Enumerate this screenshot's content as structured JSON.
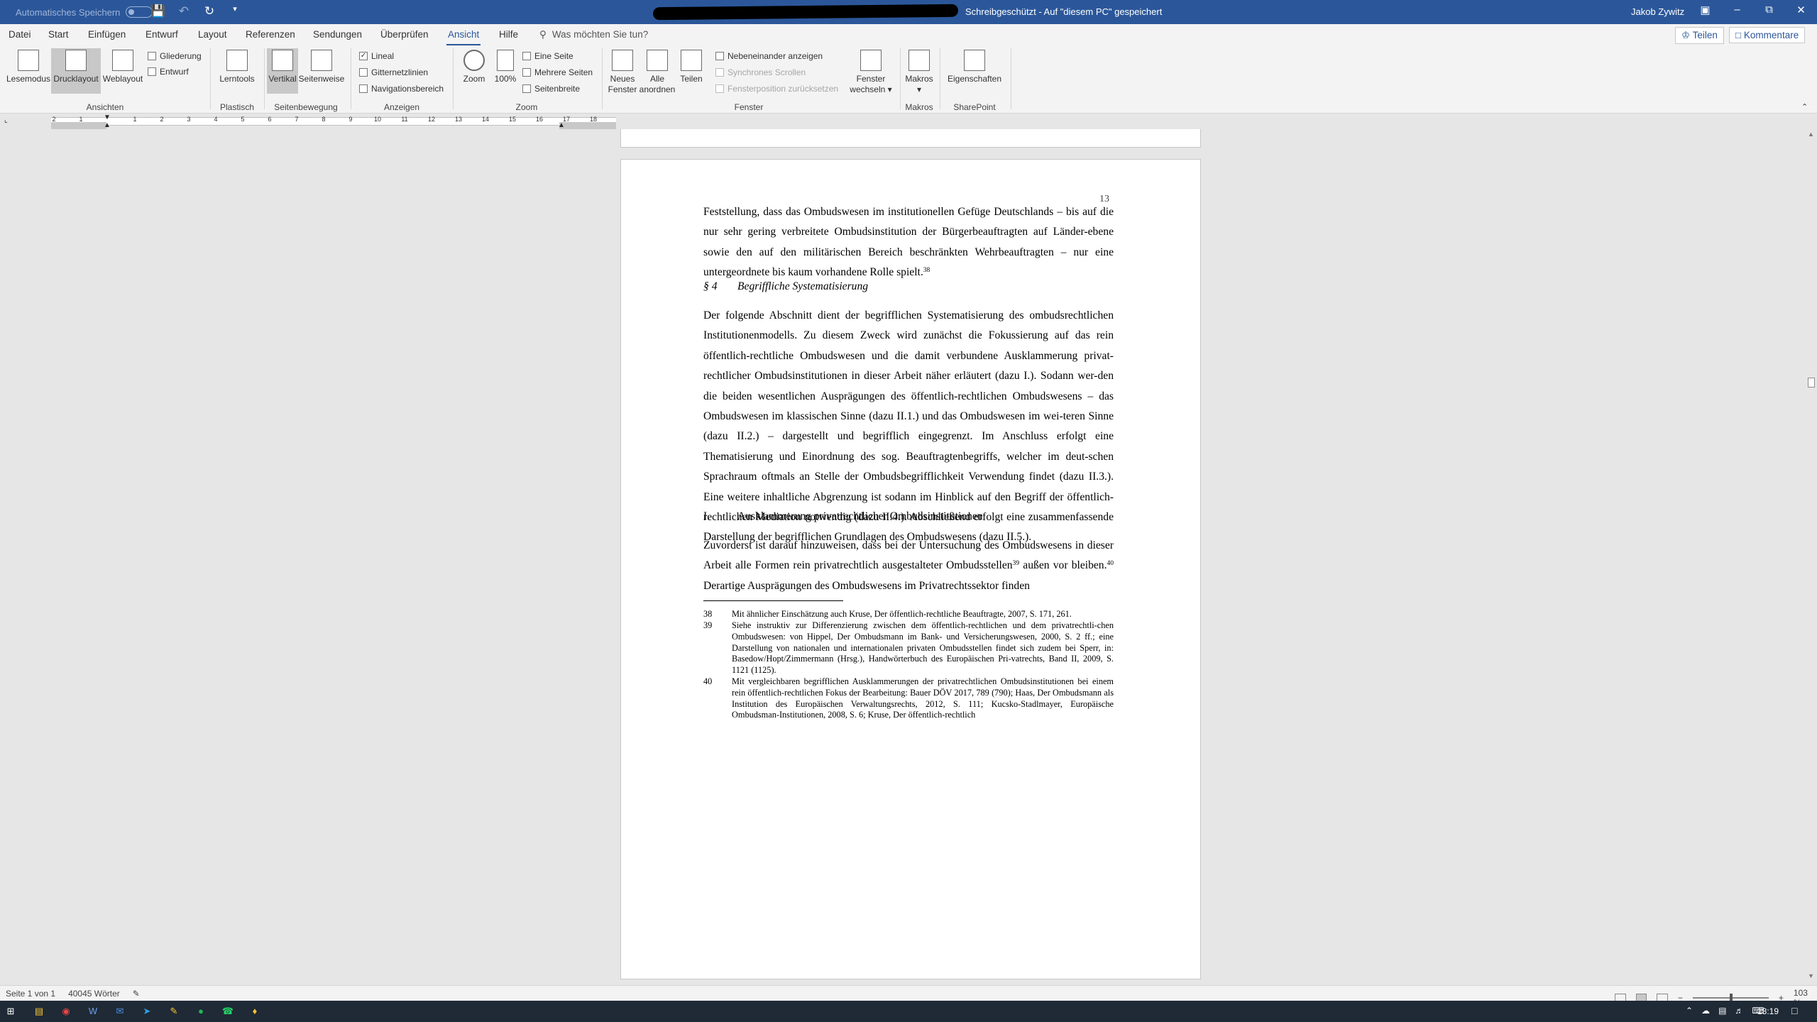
{
  "titlebar": {
    "autosave_label": "Automatisches Speichern",
    "document_status": "Schreibgeschützt - Auf \"diesem PC\" gespeichert",
    "user": "Jakob Zywitz",
    "qat_icons": [
      "save-icon",
      "undo-icon",
      "redo-icon",
      "customize-icon"
    ]
  },
  "tabs": [
    {
      "label": "Datei"
    },
    {
      "label": "Start"
    },
    {
      "label": "Einfügen"
    },
    {
      "label": "Entwurf"
    },
    {
      "label": "Layout"
    },
    {
      "label": "Referenzen"
    },
    {
      "label": "Sendungen"
    },
    {
      "label": "Überprüfen"
    },
    {
      "label": "Ansicht",
      "active": true
    },
    {
      "label": "Hilfe"
    }
  ],
  "tell_me": "Was möchten Sie tun?",
  "share_label": "Teilen",
  "comments_label": "Kommentare",
  "ribbon": {
    "ansichten": {
      "lesemodus": "Lesemodus",
      "drucklayout": "Drucklayout",
      "weblayout": "Weblayout",
      "gliederung": "Gliederung",
      "entwurf": "Entwurf",
      "group": "Ansichten"
    },
    "plastisch": {
      "lerntools": "Lerntools",
      "group": "Plastisch"
    },
    "seitenbewegung": {
      "vertikal": "Vertikal",
      "seitenweise": "Seitenweise",
      "group": "Seitenbewegung"
    },
    "anzeigen": {
      "lineal": "Lineal",
      "gitternetzlinien": "Gitternetzlinien",
      "navigationsbereich": "Navigationsbereich",
      "group": "Anzeigen",
      "lineal_checked": true,
      "gitter_checked": false,
      "nav_checked": false
    },
    "zoom": {
      "zoom": "Zoom",
      "hundert": "100%",
      "eine_seite": "Eine Seite",
      "mehrere_seiten": "Mehrere Seiten",
      "seitenbreite": "Seitenbreite",
      "group": "Zoom"
    },
    "fenster": {
      "neues": "Neues",
      "fenster_word": "Fenster",
      "alle": "Alle",
      "anordnen": "anordnen",
      "teilen": "Teilen",
      "nebeneinander": "Nebeneinander anzeigen",
      "synchron": "Synchrones Scrollen",
      "fensterposition": "Fensterposition zurücksetzen",
      "fenster2": "Fenster",
      "wechseln": "wechseln",
      "group": "Fenster"
    },
    "makros": {
      "makros": "Makros",
      "group": "Makros"
    },
    "sharepoint": {
      "eigenschaften": "Eigenschaften",
      "group": "SharePoint"
    }
  },
  "ruler_numbers": [
    "2",
    "1",
    "1",
    "2",
    "3",
    "4",
    "5",
    "6",
    "7",
    "8",
    "9",
    "10",
    "11",
    "12",
    "13",
    "14",
    "15",
    "16",
    "17",
    "18"
  ],
  "page": {
    "number": "13",
    "para1": {
      "text": "Feststellung, dass das Ombudswesen im institutionellen Gefüge Deutschlands – bis auf die nur sehr gering verbreitete Ombudsinstitution der Bürgerbeauftragten auf Länder-ebene sowie den auf den militärischen Bereich beschränkten Wehrbeauftragten – nur eine untergeordnete bis kaum vorhandene Rolle spielt.",
      "fn": "38"
    },
    "heading1": {
      "num": "§ 4",
      "title": "Begriffliche Systematisierung"
    },
    "para2": "Der folgende Abschnitt dient der begrifflichen Systematisierung des ombudsrechtlichen Institutionenmodells. Zu diesem Zweck wird zunächst die Fokussierung auf das rein öffentlich-rechtliche Ombudswesen und die damit verbundene Ausklammerung privat-rechtlicher Ombudsinstitutionen in dieser Arbeit näher erläutert (dazu I.). Sodann wer-den die beiden wesentlichen Ausprägungen des öffentlich-rechtlichen Ombudswesens – das Ombudswesen im klassischen Sinne (dazu II.1.) und das Ombudswesen im wei-teren Sinne (dazu II.2.) – dargestellt und begrifflich eingegrenzt. Im Anschluss erfolgt eine Thematisierung und Einordnung des sog. Beauftragtenbegriffs, welcher im deut-schen Sprachraum oftmals an Stelle der Ombudsbegrifflichkeit Verwendung findet (dazu II.3.). Eine weitere inhaltliche Abgrenzung ist sodann im Hinblick auf den Begriff der öffentlich-rechtlichen Mediation notwendig (dazu II.4.). Abschließend erfolgt eine zusammenfassende Darstellung der begrifflichen Grundlagen des Ombudswesens (dazu II.5.).",
    "heading2": {
      "num": "I.",
      "title": "Ausklammerung privatrechtlicher Ombudsinstitutionen"
    },
    "para3": {
      "a": "Zuvorderst ist darauf hinzuweisen, dass bei der Untersuchung des Ombudswesens in dieser Arbeit alle Formen rein privatrechtlich ausgestalteter Ombudsstellen",
      "fn39": "39",
      "b": " außen vor bleiben.",
      "fn40": "40",
      "c": " Derartige Ausprägungen des Ombudswesens im Privatrechtssektor finden"
    },
    "footnotes": [
      {
        "num": "38",
        "text": "Mit ähnlicher Einschätzung auch Kruse, Der öffentlich-rechtliche Beauftragte, 2007, S. 171, 261."
      },
      {
        "num": "39",
        "text": "Siehe instruktiv zur Differenzierung zwischen dem öffentlich-rechtlichen und dem privatrechtli-chen Ombudswesen: von Hippel, Der Ombudsmann im Bank- und Versicherungswesen, 2000, S. 2 ff.; eine Darstellung von nationalen und internationalen privaten Ombudsstellen findet sich zudem bei Sperr, in: Basedow/Hopt/Zimmermann (Hrsg.), Handwörterbuch des Europäischen Pri-vatrechts, Band II, 2009, S. 1121 (1125)."
      },
      {
        "num": "40",
        "text": "Mit vergleichbaren begrifflichen Ausklammerungen der privatrechtlichen Ombudsinstitutionen bei einem rein öffentlich-rechtlichen Fokus der Bearbeitung: Bauer DÖV 2017, 789 (790); Haas, Der Ombudsmann als Institution des Europäischen Verwaltungsrechts, 2012, S. 111; Kucsko-Stadlmayer, Europäische Ombudsman-Institutionen, 2008, S. 6; Kruse, Der öffentlich-rechtlich"
      }
    ]
  },
  "status": {
    "page": "Seite 1 von 1",
    "words": "40045 Wörter",
    "zoom": "103 %"
  },
  "taskbar": {
    "time": "13:19",
    "apps": [
      "windows-start-icon",
      "search-icon",
      "file-explorer-icon",
      "chrome-icon",
      "word-icon",
      "outlook-icon",
      "telegram-icon",
      "pen-icon",
      "spotify-icon",
      "whatsapp-icon",
      "app-icon"
    ]
  },
  "colors": {
    "word_blue": "#2b579a",
    "ribbon_bg": "#f3f3f3",
    "taskbar": "#1f2a36"
  }
}
